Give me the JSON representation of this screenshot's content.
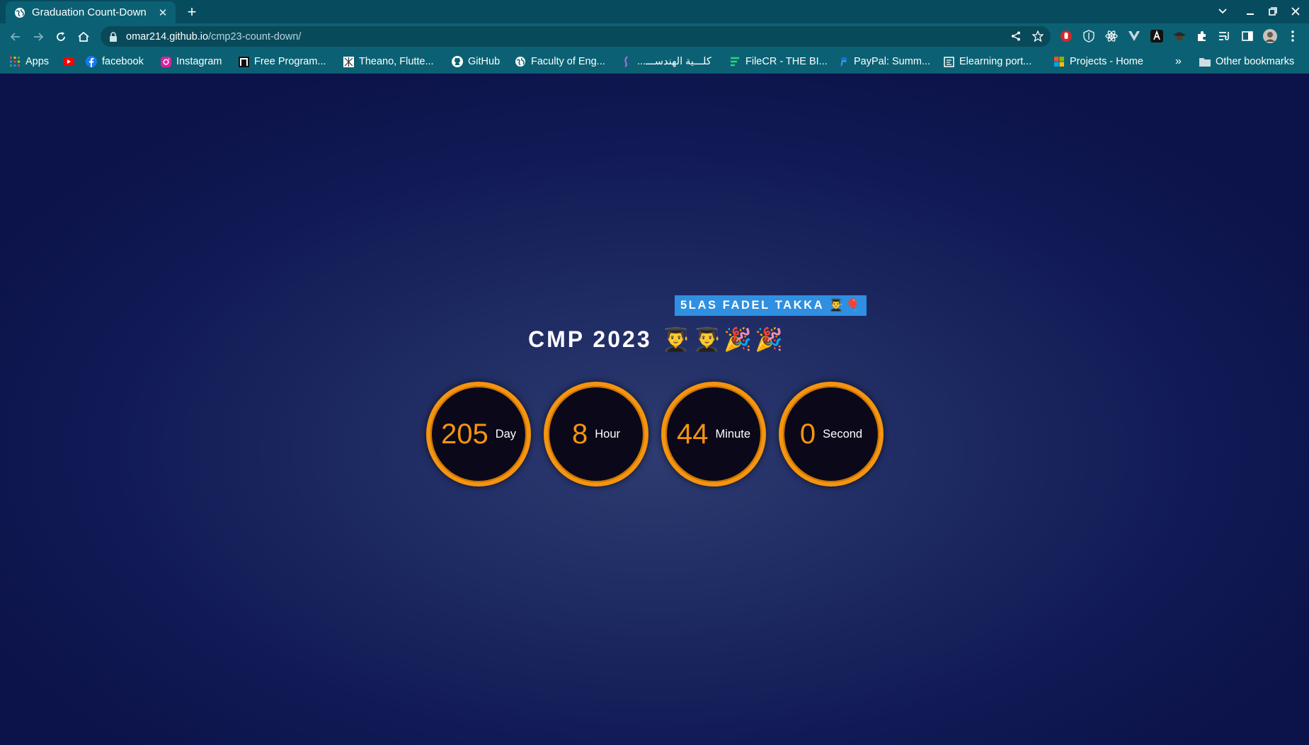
{
  "browser": {
    "tab_title": "Graduation Count-Down",
    "url_host": "omar214.github.io",
    "url_path": "/cmp23-count-down/",
    "bookmarks": [
      {
        "label": "Apps",
        "icon": "apps-grid-icon"
      },
      {
        "label": "",
        "icon": "youtube-icon"
      },
      {
        "label": "facebook",
        "icon": "facebook-icon"
      },
      {
        "label": "Instagram",
        "icon": "instagram-icon"
      },
      {
        "label": "Free Program...",
        "icon": "bookmark-site-icon"
      },
      {
        "label": "Theano, Flutte...",
        "icon": "bookmark-site-icon"
      },
      {
        "label": "GitHub",
        "icon": "github-icon"
      },
      {
        "label": "Faculty of Eng...",
        "icon": "globe-icon"
      },
      {
        "label": "كلـــية الهندســـ...",
        "icon": "bookmark-site-icon"
      },
      {
        "label": "FileCR - THE BI...",
        "icon": "filecr-icon"
      },
      {
        "label": "PayPal: Summ...",
        "icon": "paypal-icon"
      },
      {
        "label": "Elearning port...",
        "icon": "elearning-icon"
      },
      {
        "label": "Projects - Home",
        "icon": "microsoft-icon"
      }
    ],
    "overflow_label": "»",
    "other_bookmarks": "Other bookmarks"
  },
  "page": {
    "badge": "5LAS FADEL TAKKA 👨‍🎓🎈",
    "title": "CMP 2023",
    "title_emojis": "👨‍🎓👨‍🎓🎉🎉",
    "countdown": [
      {
        "value": "205",
        "unit": "Day"
      },
      {
        "value": "8",
        "unit": "Hour"
      },
      {
        "value": "44",
        "unit": "Minute"
      },
      {
        "value": "0",
        "unit": "Second"
      }
    ]
  }
}
